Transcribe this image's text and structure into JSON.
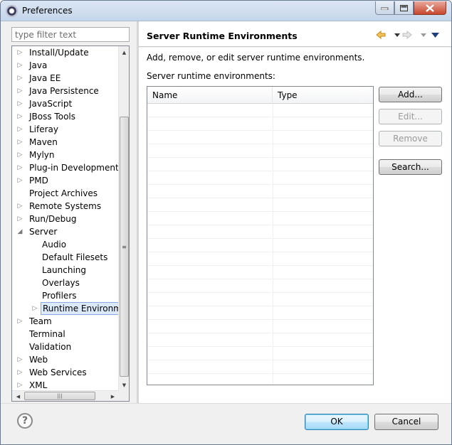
{
  "window": {
    "title": "Preferences",
    "icon": "eclipse-icon"
  },
  "filter": {
    "placeholder": "type filter text",
    "value": ""
  },
  "tree": {
    "items": [
      {
        "label": "Install/Update",
        "level": 0,
        "arrow": "collapsed"
      },
      {
        "label": "Java",
        "level": 0,
        "arrow": "collapsed"
      },
      {
        "label": "Java EE",
        "level": 0,
        "arrow": "collapsed"
      },
      {
        "label": "Java Persistence",
        "level": 0,
        "arrow": "collapsed"
      },
      {
        "label": "JavaScript",
        "level": 0,
        "arrow": "collapsed"
      },
      {
        "label": "JBoss Tools",
        "level": 0,
        "arrow": "collapsed"
      },
      {
        "label": "Liferay",
        "level": 0,
        "arrow": "collapsed"
      },
      {
        "label": "Maven",
        "level": 0,
        "arrow": "collapsed"
      },
      {
        "label": "Mylyn",
        "level": 0,
        "arrow": "collapsed"
      },
      {
        "label": "Plug-in Development",
        "level": 0,
        "arrow": "collapsed"
      },
      {
        "label": "PMD",
        "level": 0,
        "arrow": "collapsed"
      },
      {
        "label": "Project Archives",
        "level": 0,
        "arrow": "none"
      },
      {
        "label": "Remote Systems",
        "level": 0,
        "arrow": "collapsed"
      },
      {
        "label": "Run/Debug",
        "level": 0,
        "arrow": "collapsed"
      },
      {
        "label": "Server",
        "level": 0,
        "arrow": "expanded"
      },
      {
        "label": "Audio",
        "level": 1,
        "arrow": "none"
      },
      {
        "label": "Default Filesets",
        "level": 1,
        "arrow": "none"
      },
      {
        "label": "Launching",
        "level": 1,
        "arrow": "none"
      },
      {
        "label": "Overlays",
        "level": 1,
        "arrow": "none"
      },
      {
        "label": "Profilers",
        "level": 1,
        "arrow": "none"
      },
      {
        "label": "Runtime Environme",
        "level": 1,
        "arrow": "collapsed",
        "selected": true
      },
      {
        "label": "Team",
        "level": 0,
        "arrow": "collapsed"
      },
      {
        "label": "Terminal",
        "level": 0,
        "arrow": "none"
      },
      {
        "label": "Validation",
        "level": 0,
        "arrow": "none"
      },
      {
        "label": "Web",
        "level": 0,
        "arrow": "collapsed"
      },
      {
        "label": "Web Services",
        "level": 0,
        "arrow": "collapsed"
      },
      {
        "label": "XML",
        "level": 0,
        "arrow": "collapsed"
      }
    ]
  },
  "page": {
    "title": "Server Runtime Environments",
    "description": "Add, remove, or edit server runtime environments.",
    "list_label": "Server runtime environments:",
    "columns": {
      "name": "Name",
      "type": "Type"
    },
    "rows": [],
    "buttons": {
      "add": "Add...",
      "edit": "Edit...",
      "remove": "Remove",
      "search": "Search..."
    }
  },
  "footer": {
    "help": "?",
    "ok": "OK",
    "cancel": "Cancel"
  },
  "colors": {
    "selection": "#dbe9f9",
    "nav_back": "#f0a830",
    "nav_disabled": "#c0c0c0",
    "view_menu": "#1f3f7a"
  }
}
